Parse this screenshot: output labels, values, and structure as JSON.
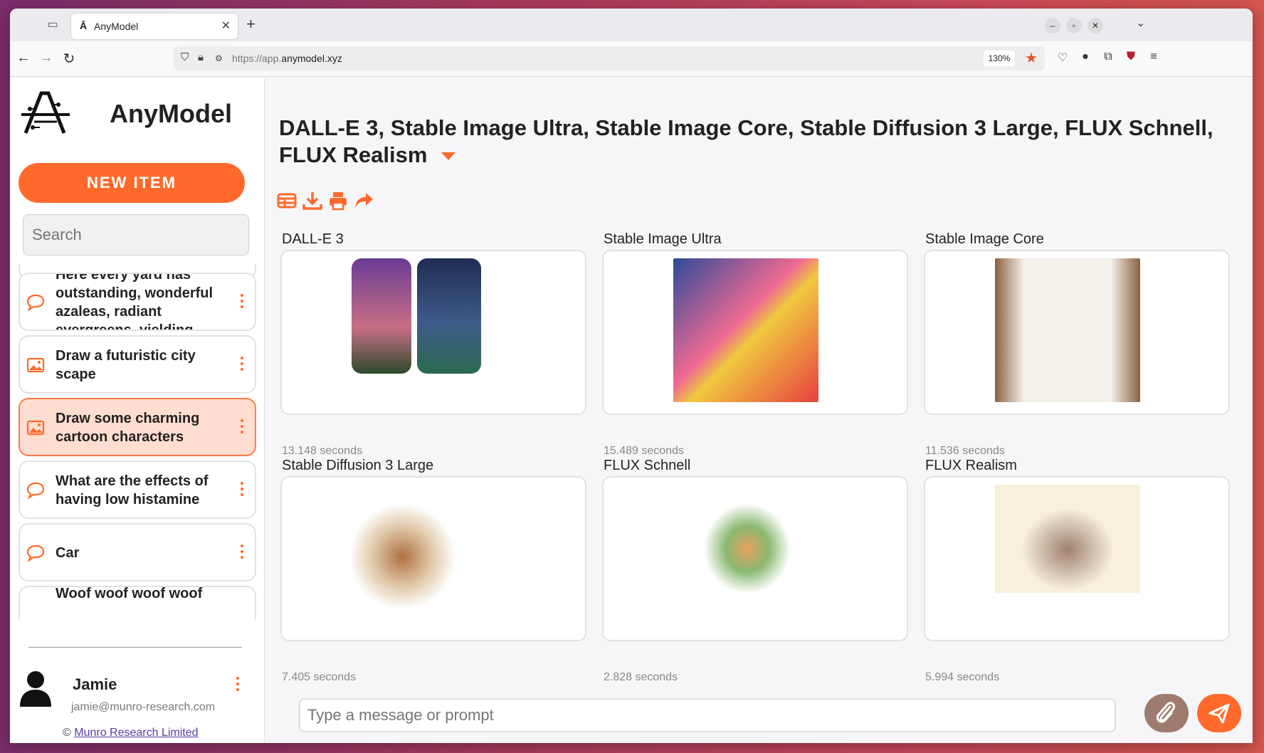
{
  "browser": {
    "tab_title": "AnyModel",
    "url_prefix": "https://app.",
    "url_domain": "anymodel.xyz",
    "zoom": "130%"
  },
  "app": {
    "brand": "AnyModel",
    "new_item_label": "NEW ITEM",
    "search_placeholder": "Search",
    "chats": [
      {
        "kind": "chat",
        "text": "Here every yard has outstanding, wonderful azaleas, radiant evergreens, yielding"
      },
      {
        "kind": "image",
        "text": "Draw a futuristic city scape"
      },
      {
        "kind": "image",
        "text": "Draw some charming cartoon characters",
        "active": true
      },
      {
        "kind": "chat",
        "text": "What are the effects of having low histamine"
      },
      {
        "kind": "chat",
        "text": "Car"
      },
      {
        "kind": "chat",
        "text": "Woof woof woof woof"
      }
    ],
    "user": {
      "name": "Jamie",
      "email": "jamie@munro-research.com"
    },
    "copyright_symbol": "©",
    "copyright_link": "Munro Research Limited"
  },
  "main": {
    "title": "DALL-E 3, Stable Image Ultra, Stable Image Core, Stable Diffusion 3 Large, FLUX Schnell, FLUX Realism",
    "results": [
      {
        "model": "DALL-E 3",
        "time": "13.148 seconds"
      },
      {
        "model": "Stable Image Ultra",
        "time": "15.489 seconds"
      },
      {
        "model": "Stable Image Core",
        "time": "11.536 seconds"
      },
      {
        "model": "Stable Diffusion 3 Large",
        "time": "7.405 seconds"
      },
      {
        "model": "FLUX Schnell",
        "time": "2.828 seconds"
      },
      {
        "model": "FLUX Realism",
        "time": "5.994 seconds"
      }
    ],
    "prompt_placeholder": "Type a message or prompt"
  },
  "colors": {
    "accent": "#ff6a2c",
    "active_bg": "#ffddd0",
    "attach": "#9e7b6e"
  }
}
